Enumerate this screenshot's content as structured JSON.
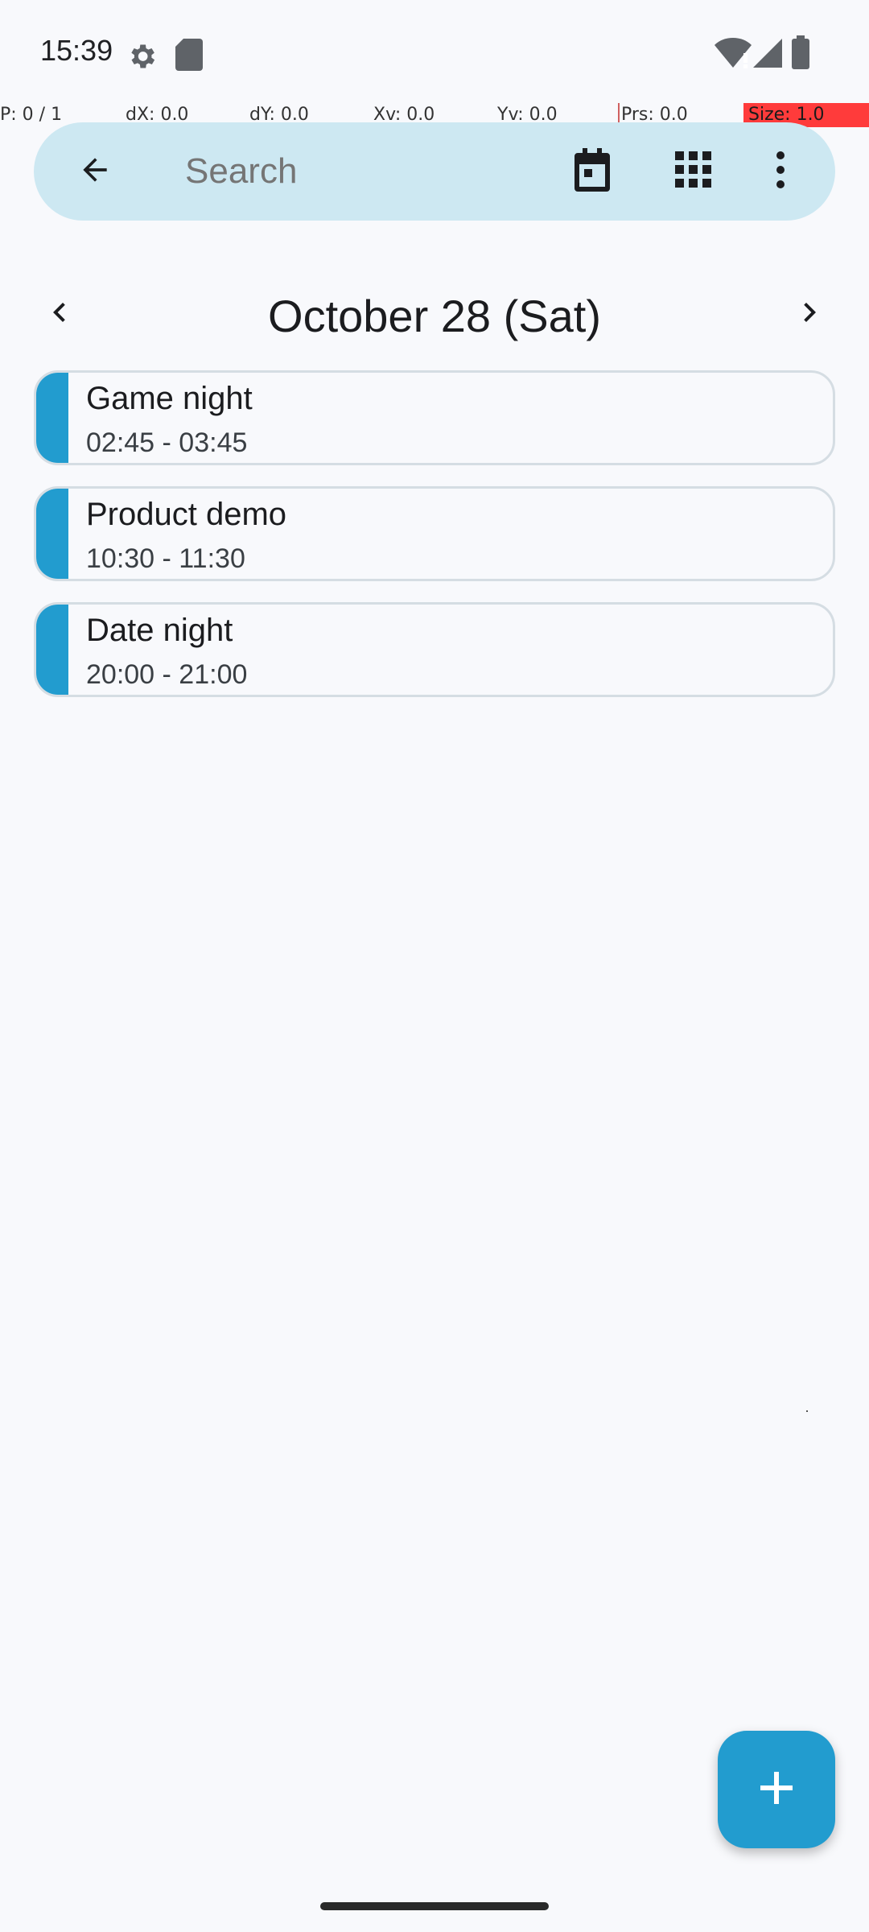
{
  "status_bar": {
    "time": "15:39",
    "icons": [
      "settings-gear-icon",
      "sd-card-icon",
      "wifi-alert-icon",
      "cell-signal-icon",
      "battery-icon"
    ]
  },
  "pointer_overlay": {
    "p": "P: 0 / 1",
    "dx": "dX: 0.0",
    "dy": "dY: 0.0",
    "xv": "Xv: 0.0",
    "yv": "Yv: 0.0",
    "prs": "Prs: 0.0",
    "size": "Size: 1.0"
  },
  "search_bar": {
    "placeholder": "Search",
    "icons": [
      "back-arrow-icon",
      "calendar-today-icon",
      "grid-view-icon",
      "more-vert-icon"
    ]
  },
  "date_nav": {
    "title": "October 28 (Sat)"
  },
  "events": [
    {
      "title": "Game night",
      "time": "02:45 - 03:45"
    },
    {
      "title": "Product demo",
      "time": "10:30 - 11:30"
    },
    {
      "title": "Date night",
      "time": "20:00 - 21:00"
    }
  ],
  "colors": {
    "accent": "#229ccf",
    "search_bg": "#cde8f2",
    "background": "#f8f9fc"
  },
  "fab": {
    "icon": "plus-icon"
  }
}
